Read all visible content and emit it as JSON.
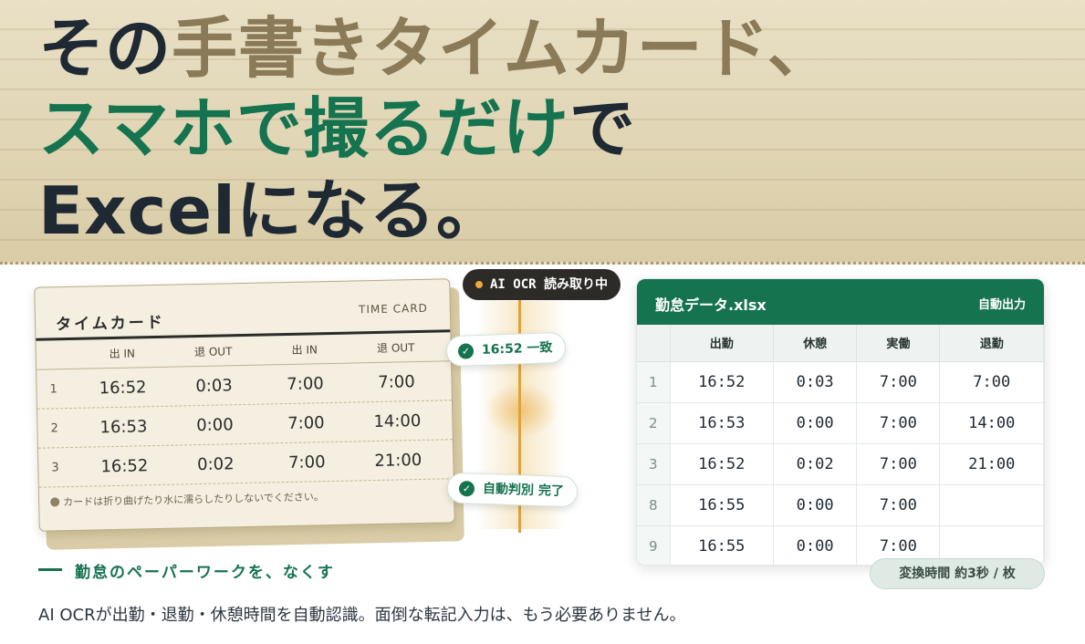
{
  "hero": {
    "line1_dark": "その",
    "line1_muted": "手書きタイムカード、",
    "line2_green": "スマホで撮るだけ",
    "line2_dark": "で",
    "line3": "Excelになる。"
  },
  "time_card": {
    "title": "タイムカード",
    "subtitle": "TIME CARD",
    "columns": [
      "出 IN",
      "退 OUT",
      "出 IN",
      "退 OUT"
    ],
    "rows": [
      {
        "no": "1",
        "cells": [
          "16:52",
          "0:03",
          "7:00",
          "7:00"
        ]
      },
      {
        "no": "2",
        "cells": [
          "16:53",
          "0:00",
          "7:00",
          "14:00"
        ]
      },
      {
        "no": "3",
        "cells": [
          "16:52",
          "0:02",
          "7:00",
          "21:00"
        ]
      }
    ],
    "note": "カードは折り曲げたり水に濡らしたりしないでください。"
  },
  "scanner": {
    "status": "AI OCR 読み取り中",
    "chip_match": "16:52 一致",
    "chip_done": "自動判別 完了"
  },
  "sheet": {
    "title": "勤怠データ.xlsx",
    "tag": "自動出力",
    "headers": [
      "",
      "出勤",
      "休憩",
      "実働",
      "退勤"
    ],
    "rows": [
      {
        "no": "1",
        "cells": [
          "16:52",
          "0:03",
          "7:00",
          "7:00"
        ]
      },
      {
        "no": "2",
        "cells": [
          "16:53",
          "0:00",
          "7:00",
          "14:00"
        ]
      },
      {
        "no": "3",
        "cells": [
          "16:52",
          "0:02",
          "7:00",
          "21:00"
        ]
      },
      {
        "no": "8",
        "cells": [
          "16:55",
          "0:00",
          "7:00",
          ""
        ]
      },
      {
        "no": "9",
        "cells": [
          "16:55",
          "0:00",
          "7:00",
          ""
        ]
      }
    ],
    "conversion": "変換時間 約3秒 / 枚"
  },
  "copy": {
    "tagline": "勤怠のペーパーワークを、なくす",
    "description": "AI OCRが出勤・退勤・休憩時間を自動認識。面倒な転記入力は、もう必要ありません。"
  },
  "colors": {
    "accent_green": "#16734f",
    "hero_bg": "#dccfac",
    "scan_orange": "#e0a23a"
  }
}
